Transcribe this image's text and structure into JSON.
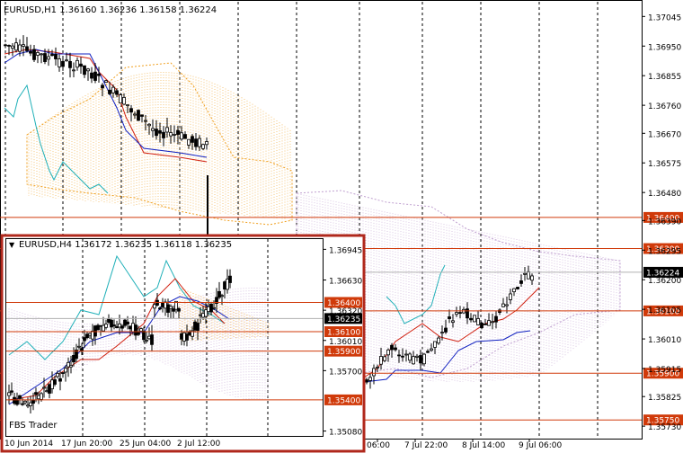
{
  "main": {
    "header": "EURUSD,H1  1.36160 1.36236 1.36158 1.36224",
    "y_ticks": [
      "1.37045",
      "1.36950",
      "1.36855",
      "1.36760",
      "1.36670",
      "1.36575",
      "1.36480",
      "1.36390",
      "1.36295",
      "1.36200",
      "1.36105",
      "1.36010",
      "1.35915",
      "1.35825",
      "1.35730"
    ],
    "x_ticks": [
      "06:00",
      "7 Jul 22:00",
      "8 Jul 14:00",
      "9 Jul 06:00"
    ],
    "hlines": [
      {
        "price": "1.36400",
        "color": "#d03a0a"
      },
      {
        "price": "1.36300",
        "color": "#d03a0a"
      },
      {
        "price": "1.36100",
        "color": "#d03a0a"
      },
      {
        "price": "1.35900",
        "color": "#d03a0a"
      },
      {
        "price": "1.35750",
        "color": "#d03a0a"
      }
    ],
    "current_price": "1.36224"
  },
  "inset": {
    "header": "EURUSD,H4  1.36172 1.36235 1.36118 1.36235",
    "y_ticks": [
      "1.36945",
      "1.36630",
      "1.36320",
      "1.36010",
      "1.35700",
      "1.35080"
    ],
    "x_ticks": [
      "10 Jun 2014",
      "17 Jun 20:00",
      "25 Jun 04:00",
      "2 Jul 12:00"
    ],
    "hlines": [
      {
        "price": "1.36400",
        "color": "#d03a0a"
      },
      {
        "price": "1.36100",
        "color": "#d03a0a"
      },
      {
        "price": "1.35900",
        "color": "#d03a0a"
      },
      {
        "price": "1.35400",
        "color": "#d03a0a"
      }
    ],
    "current_price": "1.36235",
    "watermark": "FBS Trader"
  },
  "colors": {
    "frame": "#b0281c",
    "level_line": "#d03a0a",
    "kumo_orange": "#f0a020",
    "kumo_violet": "#c0a0d0",
    "tenkan": "#d02010",
    "kijun": "#1020c0",
    "chikou": "#20b0b8",
    "candle": "#000000"
  }
}
